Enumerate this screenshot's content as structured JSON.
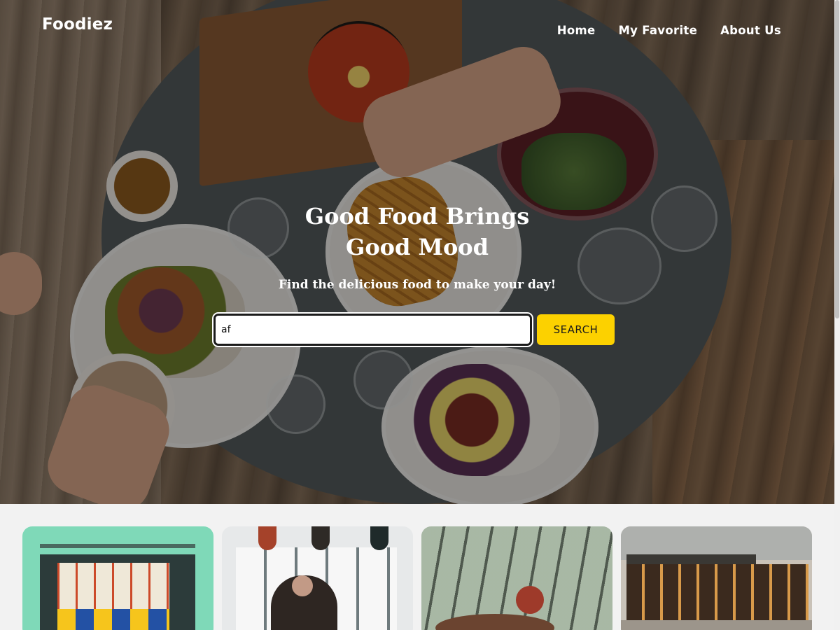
{
  "header": {
    "brand": "Foodiez",
    "nav": [
      {
        "label": "Home"
      },
      {
        "label": "My Favorite"
      },
      {
        "label": "About Us"
      }
    ]
  },
  "hero": {
    "headline_line1": "Good Food Brings",
    "headline_line2": "Good Mood",
    "subheadline": "Find the delicious food to make your day!",
    "search": {
      "value": "af",
      "button_label": "SEARCH"
    }
  },
  "cards": [
    {
      "icon": "restaurant-storefront-photo"
    },
    {
      "icon": "cafe-interior-photo"
    },
    {
      "icon": "greenhouse-cafe-photo"
    },
    {
      "icon": "street-cafe-photo"
    }
  ],
  "colors": {
    "accent": "#fcd100",
    "text_on_hero": "#ffffff",
    "page_background": "#f2f2f2"
  }
}
